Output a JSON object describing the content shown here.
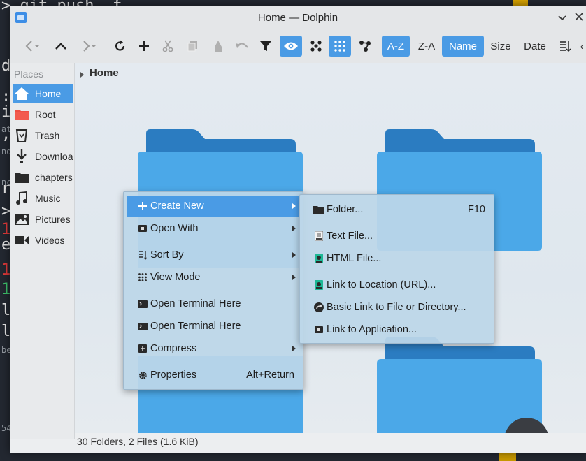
{
  "terminal": {
    "lines": [
      "> git push -f",
      "d",
      ":",
      "ii",
      "ate",
      ",",
      "nd",
      "r",
      "nce",
      ">",
      "1",
      "e",
      "1",
      "1",
      "ll",
      "l",
      "be",
      "54"
    ]
  },
  "window": {
    "title": "Home — Dolphin"
  },
  "toolbar": {
    "sort_az": "A-Z",
    "sort_za": "Z-A",
    "sort_name": "Name",
    "sort_size": "Size",
    "sort_date": "Date"
  },
  "places": {
    "title": "Places",
    "items": [
      {
        "label": "Home",
        "icon": "home-icon",
        "selected": true
      },
      {
        "label": "Root",
        "icon": "folder-red-icon"
      },
      {
        "label": "Trash",
        "icon": "trash-icon"
      },
      {
        "label": "Downloads",
        "icon": "download-icon"
      },
      {
        "label": "chapters",
        "icon": "folder-icon"
      },
      {
        "label": "Music",
        "icon": "music-icon"
      },
      {
        "label": "Pictures",
        "icon": "pictures-icon"
      },
      {
        "label": "Videos",
        "icon": "video-icon"
      }
    ]
  },
  "breadcrumb": {
    "current": "Home"
  },
  "status": {
    "text": "30 Folders, 2 Files (1.6 KiB)"
  },
  "context_menu": {
    "items": [
      {
        "label": "Create New",
        "icon": "plus-icon",
        "submenu": true,
        "highlighted": true
      },
      {
        "label": "Open With",
        "icon": "open-with-icon",
        "submenu": true
      },
      {
        "label": "Sort By",
        "icon": "sort-icon",
        "submenu": true
      },
      {
        "label": "View Mode",
        "icon": "grid-icon",
        "submenu": true
      },
      {
        "label": "Open Terminal Here",
        "icon": "terminal-icon"
      },
      {
        "label": "Open Terminal Here",
        "icon": "terminal-icon"
      },
      {
        "label": "Compress",
        "icon": "compress-icon",
        "submenu": true
      },
      {
        "label": "Properties",
        "icon": "gear-icon",
        "shortcut": "Alt+Return"
      }
    ]
  },
  "create_new_menu": {
    "items": [
      {
        "label": "Folder...",
        "icon": "folder-icon",
        "shortcut": "F10"
      },
      {
        "label": "Text File...",
        "icon": "text-file-icon"
      },
      {
        "label": "HTML File...",
        "icon": "html-file-icon"
      },
      {
        "label": "Link to Location (URL)...",
        "icon": "link-url-icon"
      },
      {
        "label": "Basic Link to File or Directory...",
        "icon": "link-icon"
      },
      {
        "label": "Link to Application...",
        "icon": "application-icon"
      }
    ]
  },
  "colors": {
    "accent": "#4a9be5",
    "folder_dark": "#2b7cc1",
    "folder_light": "#4ba8e8"
  }
}
